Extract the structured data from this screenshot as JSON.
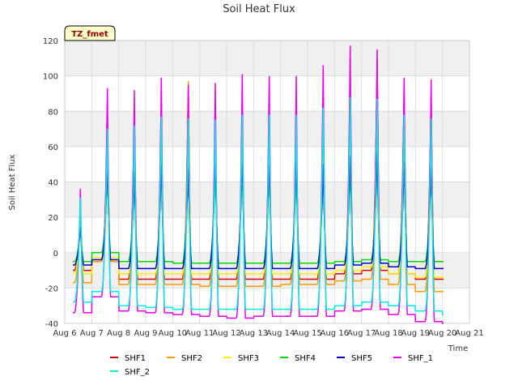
{
  "chart_data": {
    "type": "line",
    "title": "Soil Heat Flux",
    "xlabel": "Time",
    "ylabel": "Soil Heat Flux",
    "annotation": "TZ_fmet",
    "ylim": [
      -40,
      120
    ],
    "xlim": [
      6,
      21
    ],
    "x_ticks": [
      6,
      7,
      8,
      9,
      10,
      11,
      12,
      13,
      14,
      15,
      16,
      17,
      18,
      19,
      20,
      21
    ],
    "x_tick_labels": [
      "Aug 6",
      "Aug 7",
      "Aug 8",
      "Aug 9",
      "Aug 10",
      "Aug 11",
      "Aug 12",
      "Aug 13",
      "Aug 14",
      "Aug 15",
      "Aug 16",
      "Aug 17",
      "Aug 18",
      "Aug 19",
      "Aug 20",
      "Aug 21"
    ],
    "y_ticks": [
      -40,
      -20,
      0,
      20,
      40,
      60,
      80,
      100,
      120
    ],
    "grid": true,
    "legend_position": "bottom",
    "series": [
      {
        "name": "SHF1",
        "color": "#dd0000",
        "day_start": 6.3,
        "peaks": [
          22,
          70,
          80,
          80,
          93,
          68,
          68,
          72,
          72,
          70,
          88,
          108,
          92,
          90,
          82
        ],
        "mins": [
          -10,
          -5,
          -15,
          -15,
          -15,
          -15,
          -15,
          -15,
          -15,
          -15,
          -12,
          -10,
          -12,
          -15,
          -15
        ]
      },
      {
        "name": "SHF2",
        "color": "#ff9900",
        "day_start": 6.3,
        "peaks": [
          20,
          65,
          75,
          75,
          97,
          70,
          70,
          72,
          72,
          70,
          80,
          110,
          88,
          85,
          80
        ],
        "mins": [
          -17,
          -5,
          -18,
          -18,
          -18,
          -19,
          -19,
          -19,
          -18,
          -18,
          -16,
          -15,
          -18,
          -22,
          -22
        ]
      },
      {
        "name": "SHF3",
        "color": "#ffee00",
        "day_start": 6.3,
        "peaks": [
          18,
          55,
          60,
          60,
          75,
          60,
          60,
          60,
          60,
          58,
          65,
          80,
          70,
          68,
          65
        ],
        "mins": [
          -12,
          -3,
          -12,
          -12,
          -12,
          -12,
          -12,
          -12,
          -12,
          -12,
          -10,
          -8,
          -12,
          -14,
          -14
        ]
      },
      {
        "name": "SHF4",
        "color": "#00dd00",
        "day_start": 6.3,
        "peaks": [
          15,
          45,
          48,
          48,
          52,
          48,
          48,
          48,
          48,
          46,
          50,
          58,
          52,
          50,
          48
        ],
        "mins": [
          -5,
          0,
          -5,
          -5,
          -6,
          -6,
          -6,
          -6,
          -6,
          -6,
          -5,
          -4,
          -5,
          -5,
          -5
        ]
      },
      {
        "name": "SHF5",
        "color": "#0000cc",
        "day_start": 6.3,
        "peaks": [
          14,
          51,
          45,
          52,
          48,
          55,
          55,
          53,
          52,
          50,
          55,
          56,
          52,
          50,
          49
        ],
        "mins": [
          -7,
          -4,
          -9,
          -9,
          -9,
          -9,
          -9,
          -9,
          -9,
          -9,
          -7,
          -6,
          -8,
          -9,
          -9
        ]
      },
      {
        "name": "SHF_1",
        "color": "#ee00ee",
        "day_start": 6.3,
        "peaks": [
          36,
          93,
          92,
          99,
          95,
          96,
          101,
          100,
          100,
          106,
          117,
          115,
          99,
          98,
          98
        ],
        "mins": [
          -34,
          -25,
          -33,
          -34,
          -35,
          -36,
          -37,
          -36,
          -36,
          -36,
          -33,
          -32,
          -35,
          -39,
          -40
        ]
      },
      {
        "name": "SHF_2",
        "color": "#00eeee",
        "day_start": 6.3,
        "peaks": [
          31,
          70,
          72,
          77,
          76,
          75,
          78,
          78,
          78,
          82,
          88,
          87,
          78,
          76,
          75
        ],
        "mins": [
          -28,
          -22,
          -30,
          -31,
          -32,
          -32,
          -32,
          -32,
          -32,
          -32,
          -30,
          -28,
          -30,
          -33,
          -35
        ]
      }
    ]
  }
}
